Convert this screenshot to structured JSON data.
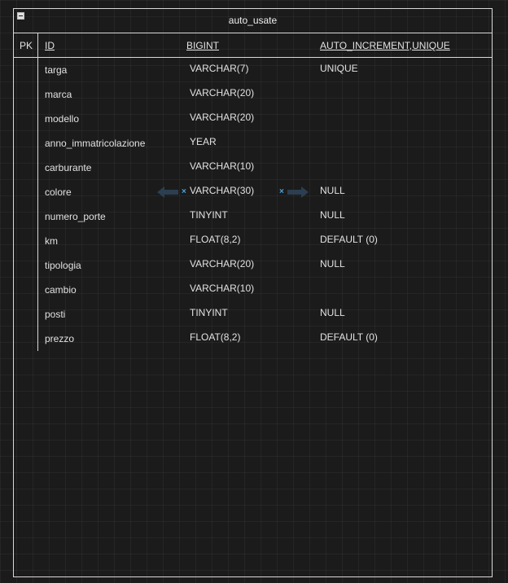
{
  "table": {
    "title": "auto_usate",
    "pk_label": "PK",
    "pk_field": {
      "name": "ID",
      "type": "BIGINT",
      "extra": "AUTO_INCREMENT,UNIQUE"
    },
    "fields": [
      {
        "name": "targa",
        "type": "VARCHAR(7)",
        "extra": "UNIQUE"
      },
      {
        "name": "marca",
        "type": "VARCHAR(20)",
        "extra": ""
      },
      {
        "name": "modello",
        "type": "VARCHAR(20)",
        "extra": ""
      },
      {
        "name": "anno_immatricolazione",
        "type": "YEAR",
        "extra": ""
      },
      {
        "name": "carburante",
        "type": "VARCHAR(10)",
        "extra": ""
      },
      {
        "name": "colore",
        "type": "VARCHAR(30)",
        "extra": "NULL"
      },
      {
        "name": "numero_porte",
        "type": "TINYINT",
        "extra": "NULL"
      },
      {
        "name": "km",
        "type": "FLOAT(8,2)",
        "extra": "DEFAULT (0)"
      },
      {
        "name": "tipologia",
        "type": "VARCHAR(20)",
        "extra": "NULL"
      },
      {
        "name": "cambio",
        "type": "VARCHAR(10)",
        "extra": ""
      },
      {
        "name": "posti",
        "type": "TINYINT",
        "extra": "NULL"
      },
      {
        "name": "prezzo",
        "type": "FLOAT(8,2)",
        "extra": "DEFAULT (0)"
      }
    ]
  },
  "colors": {
    "background": "#1b1b1b",
    "border": "#d9d9d9",
    "text": "#e2e2e2",
    "handle": "#4aa3df",
    "arrow": "#2c3e50"
  },
  "icons": {
    "collapse": "minus-box-icon",
    "arrow_left": "arrow-left-icon",
    "arrow_right": "arrow-right-icon",
    "handle": "resize-handle-icon"
  }
}
